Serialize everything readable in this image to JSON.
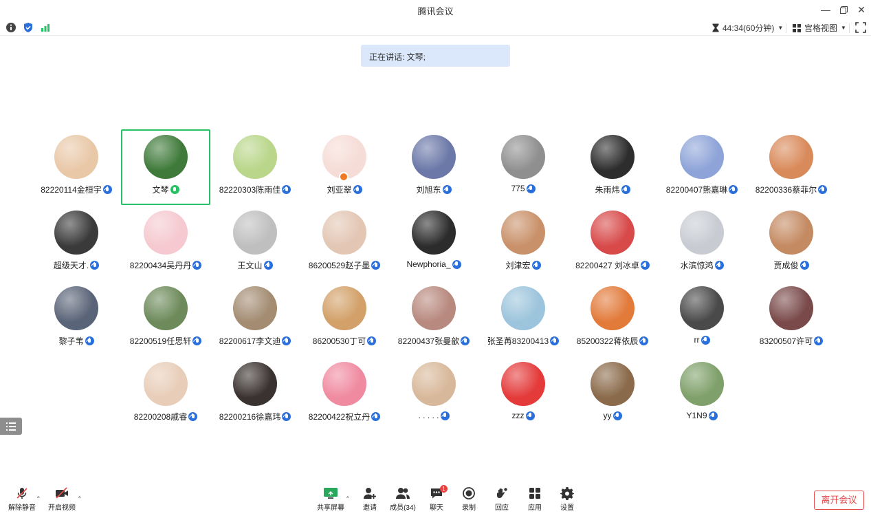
{
  "window": {
    "title": "腾讯会议"
  },
  "infobar": {
    "timer": "44:34(60分钟)",
    "view_mode": "宫格视图"
  },
  "speaking": {
    "text": "正在讲话: 文琴;"
  },
  "colors": {
    "accent": "#2a6fdb",
    "active_speaker": "#27c265",
    "leave": "#e54a4a",
    "speaking_bg": "#dbe8fb"
  },
  "participants": [
    {
      "name": "82220114金桓宇",
      "avatar_color": "#e9c8a8",
      "mic": "blue"
    },
    {
      "name": "文琴",
      "avatar_color": "#3f7a3a",
      "mic": "green",
      "active": true
    },
    {
      "name": "82220303陈雨佳",
      "avatar_color": "#b9d68a",
      "mic": "blue"
    },
    {
      "name": "刘亚翠",
      "avatar_color": "#f6dcd6",
      "mic": "blue",
      "host": true
    },
    {
      "name": "刘旭东",
      "avatar_color": "#6b78a8",
      "mic": "blue"
    },
    {
      "name": "775",
      "avatar_color": "#8f8f8f",
      "mic": "blue"
    },
    {
      "name": "朱雨炜",
      "avatar_color": "#2d2d2d",
      "mic": "blue"
    },
    {
      "name": "82200407熊嘉琳",
      "avatar_color": "#8ea4d8",
      "mic": "blue"
    },
    {
      "name": "82200336蔡菲尔",
      "avatar_color": "#d98a5a",
      "mic": "blue"
    },
    {
      "name": "超级天才.",
      "avatar_color": "#3a3a3a",
      "mic": "blue"
    },
    {
      "name": "82200434吴丹丹",
      "avatar_color": "#f5c9cf",
      "mic": "blue"
    },
    {
      "name": "王文山",
      "avatar_color": "#bfbfbf",
      "mic": "blue"
    },
    {
      "name": "86200529赵子墨",
      "avatar_color": "#e3c6b4",
      "mic": "blue"
    },
    {
      "name": "Newphoria_",
      "avatar_color": "#2c2c2c",
      "mic": "blue"
    },
    {
      "name": "刘津宏",
      "avatar_color": "#c9916a",
      "mic": "blue"
    },
    {
      "name": "82200427 刘冰卓",
      "avatar_color": "#d84a4a",
      "mic": "blue"
    },
    {
      "name": "水滨惊鸿",
      "avatar_color": "#c8ccd2",
      "mic": "blue"
    },
    {
      "name": "贾成俊",
      "avatar_color": "#c48a62",
      "mic": "blue"
    },
    {
      "name": "黎子苇",
      "avatar_color": "#5a6478",
      "mic": "blue"
    },
    {
      "name": "82200519任思轩",
      "avatar_color": "#6d8a5a",
      "mic": "blue"
    },
    {
      "name": "82200617李文迪",
      "avatar_color": "#a38c72",
      "mic": "blue"
    },
    {
      "name": "86200530丁可",
      "avatar_color": "#d2a068",
      "mic": "blue"
    },
    {
      "name": "82200437张曼歆",
      "avatar_color": "#b8897e",
      "mic": "blue"
    },
    {
      "name": "张圣苒83200413",
      "avatar_color": "#9cc4dc",
      "mic": "blue"
    },
    {
      "name": "85200322蒋依辰",
      "avatar_color": "#e27a3a",
      "mic": "blue"
    },
    {
      "name": "rr",
      "avatar_color": "#4a4a4a",
      "mic": "blue"
    },
    {
      "name": "83200507许可",
      "avatar_color": "#7a4a4a",
      "mic": "blue"
    },
    {
      "name": "82200208戚睿",
      "avatar_color": "#e8cdb8",
      "mic": "blue"
    },
    {
      "name": "82200216徐嘉玮",
      "avatar_color": "#3a3230",
      "mic": "blue"
    },
    {
      "name": "82200422祝立丹",
      "avatar_color": "#f08aa0",
      "mic": "blue"
    },
    {
      "name": ". . . . .",
      "avatar_color": "#d8b89a",
      "mic": "blue"
    },
    {
      "name": "zzz",
      "avatar_color": "#e43a3a",
      "mic": "blue"
    },
    {
      "name": "yy",
      "avatar_color": "#8a6a4a",
      "mic": "blue"
    },
    {
      "name": "Y1N9",
      "avatar_color": "#7fa06a",
      "mic": "blue"
    }
  ],
  "toolbar": {
    "unmute": "解除静音",
    "start_video": "开启视频",
    "share_screen": "共享屏幕",
    "invite": "邀请",
    "members": "成员(34)",
    "chat": "聊天",
    "chat_badge": "1",
    "record": "录制",
    "reactions": "回应",
    "apps": "应用",
    "settings": "设置",
    "leave": "离开会议"
  }
}
